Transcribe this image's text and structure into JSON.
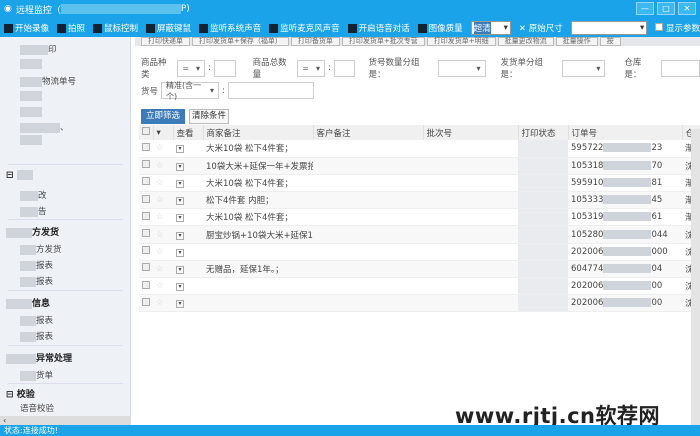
{
  "window": {
    "title": "远程监控（",
    "title_tail": "P)",
    "controls": [
      "—",
      "□",
      "✕"
    ]
  },
  "toolbar": {
    "items": [
      {
        "label": "开始录像",
        "icon": "video-camera-icon"
      },
      {
        "label": "拍照",
        "icon": "camera-icon"
      },
      {
        "label": "鼠标控制",
        "icon": "mouse-icon"
      },
      {
        "label": "屏蔽键鼠",
        "icon": "keyboard-icon"
      },
      {
        "label": "监听系统声音",
        "icon": "speaker-icon"
      },
      {
        "label": "监听麦克风声音",
        "icon": "speaker-icon"
      },
      {
        "label": "开启语音对话",
        "icon": "microphone-icon"
      },
      {
        "label": "图像质量",
        "icon": "image-quality-icon"
      }
    ],
    "quality_value": "超清",
    "original_size": "原始尺寸",
    "size_value": "",
    "show_params": "显示参数"
  },
  "accent": "#1aa3e8",
  "top_buttons": [
    "打印快递单",
    "打印发货单+保存（福单）",
    "打印备货单",
    "打印发货单+批次专营",
    "打印发货单+明细",
    "批量更改物流",
    "批量操作",
    "按"
  ],
  "sidebar": {
    "items": [
      {
        "label": "印"
      },
      {
        "label": ""
      },
      {
        "label": "物流单号"
      },
      {
        "label": ""
      },
      {
        "label": ""
      },
      {
        "label": "、"
      },
      {
        "label": ""
      }
    ],
    "groups": [
      {
        "title": "",
        "items": [
          "改",
          "告"
        ]
      },
      {
        "title": "方发货",
        "items": [
          "方发货",
          "报表",
          "报表"
        ]
      },
      {
        "title": "信息",
        "items": [
          "报表",
          "报表"
        ]
      },
      {
        "title": "异常处理",
        "items": [
          "货单"
        ]
      },
      {
        "title": "校验",
        "items": [
          "语音校验"
        ]
      }
    ]
  },
  "filters": {
    "product_type": "商品种类",
    "product_type_op": "=",
    "product_total": "商品总数量",
    "product_total_op": "=",
    "sku_group": "货号数量分组是：",
    "ship_group": "发货单分组是：",
    "warehouse": "仓库是：",
    "sku": "货号",
    "sku_mode": "精准(含一个)",
    "sku_value": "",
    "apply": "立即筛选",
    "clear": "清除条件"
  },
  "table": {
    "headers": [
      "",
      "",
      "查看",
      "商家备注",
      "客户备注",
      "批次号",
      "打印状态",
      "订单号",
      "仓"
    ],
    "rows": [
      {
        "merchant_note": "大米10袋 松下4件套；",
        "order": "595722",
        "order_tail": "23",
        "wh": "渐"
      },
      {
        "merchant_note": "10袋大米+延保一年+发票抬头—",
        "order": "105318",
        "order_tail": "70",
        "wh": "沈"
      },
      {
        "merchant_note": "大米10袋 松下4件套；",
        "order": "595910",
        "order_tail": "81",
        "wh": "渐"
      },
      {
        "merchant_note": "松下4件套 内胆；",
        "order": "105333",
        "order_tail": "45",
        "wh": "渐"
      },
      {
        "merchant_note": "大米10袋 松下4件套；",
        "order": "105319",
        "order_tail": "61",
        "wh": "渐"
      },
      {
        "merchant_note": "厨宝炒锅+10袋大米+延保1年；",
        "order": "105280",
        "order_tail": "044",
        "wh": "沈"
      },
      {
        "merchant_note": "",
        "order": "202006",
        "order_tail": "000",
        "wh": "沈"
      },
      {
        "merchant_note": "无赠品，延保1年。；",
        "order": "604774",
        "order_tail": "04",
        "wh": "沈"
      },
      {
        "merchant_note": "",
        "order": "202006",
        "order_tail": "00",
        "wh": "沈"
      },
      {
        "merchant_note": "",
        "order": "202006",
        "order_tail": "00",
        "wh": "沈"
      }
    ]
  },
  "status": "状态:连接成功!",
  "watermark": "www.rjtj.cn软荐网"
}
